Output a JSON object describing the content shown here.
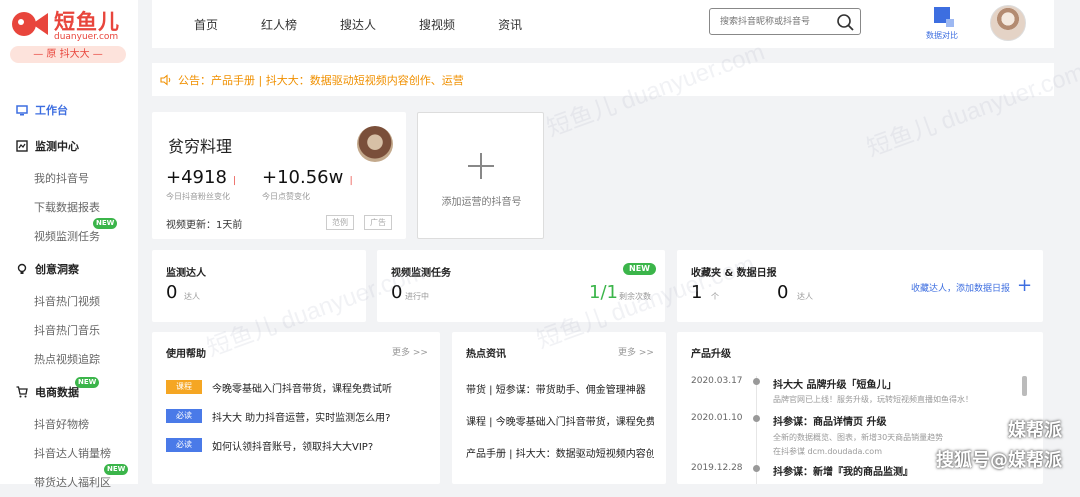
{
  "logo": {
    "brand": "短鱼儿",
    "domain": "duanyuer.com",
    "tagline": "— 原 抖大大 —",
    "accent": "#e8453c"
  },
  "sidebar": {
    "workbench": "工作台",
    "groups": [
      {
        "label": "监测中心",
        "items": [
          "我的抖音号",
          "下载数据报表",
          "视频监测任务"
        ]
      },
      {
        "label": "创意洞察",
        "items": [
          "抖音热门视频",
          "抖音热门音乐",
          "热点视频追踪"
        ]
      },
      {
        "label": "电商数据",
        "items": [
          "抖音好物榜",
          "抖音达人销量榜",
          "带货达人福利区"
        ]
      }
    ],
    "new_badge": "NEW"
  },
  "nav": {
    "items": [
      "首页",
      "红人榜",
      "搜达人",
      "搜视频",
      "资讯"
    ]
  },
  "search": {
    "placeholder": "搜索抖音昵称或抖音号"
  },
  "compare": {
    "label": "数据对比"
  },
  "notice": {
    "text": "公告：产品手册 | 抖大大：数据驱动短视频内容创作、运营"
  },
  "account": {
    "name": "贫穷料理",
    "fans_delta": "+4918",
    "fans_label": "今日抖音粉丝变化",
    "likes_delta": "+10.56w",
    "likes_label": "今日点赞变化",
    "updated": "视频更新：1天前",
    "tag1": "范例",
    "tag2": "广告"
  },
  "add_account": {
    "label": "添加运营的抖音号"
  },
  "monitor": {
    "title": "监测达人",
    "value": "0",
    "unit": "达人"
  },
  "video_task": {
    "title": "视频监测任务",
    "badge": "NEW",
    "running_value": "0",
    "running_label": "进行中",
    "remaining_value": "1/1",
    "remaining_label": "剩余次数"
  },
  "favorites": {
    "title": "收藏夹 & 数据日报",
    "count1": "1",
    "unit1": "个",
    "count2": "0",
    "unit2": "达人",
    "link": "收藏达人，添加数据日报"
  },
  "help": {
    "title": "使用帮助",
    "more": "更多 >>",
    "rows": [
      {
        "tag": "课程",
        "text": "今晚零基础入门抖音带货，课程免费试听",
        "color": "#f5a623"
      },
      {
        "tag": "必读",
        "text": "抖大大 助力抖音运营，实时监测怎么用?",
        "color": "#4a7ae8"
      },
      {
        "tag": "必读",
        "text": "如何认领抖音账号，领取抖大大VIP?",
        "color": "#4a7ae8"
      }
    ]
  },
  "hot_news": {
    "title": "热点资讯",
    "more": "更多 >>",
    "rows": [
      "带货 | 短参谋：带货助手、佣金管理神器",
      "课程 | 今晚零基础入门抖音带货，课程免费",
      "产品手册 | 抖大大：数据驱动短视频内容创"
    ]
  },
  "upgrades": {
    "title": "产品升级",
    "rows": [
      {
        "date": "2020.03.17",
        "title": "抖大大 品牌升级「短鱼儿」",
        "desc": [
          "品牌官网已上线！服务升级，玩转短视频直播如鱼得水！"
        ]
      },
      {
        "date": "2020.01.10",
        "title": "抖参谋：商品详情页 升级",
        "desc": [
          "全新的数据概览、图表，新增30天商品销量趋势",
          "在抖参谋 dcm.doudada.com"
        ]
      },
      {
        "date": "2019.12.28",
        "title": "抖参谋：新增『我的商品监测』",
        "desc": []
      }
    ]
  },
  "watermarks": [
    "短鱼儿 duanyuer.com",
    "短鱼儿 duanyuer.com",
    "短鱼儿 duanyuer.com",
    "短鱼儿 duanyuer.com"
  ],
  "signature": {
    "line1": "媒帮派",
    "line2": "搜狐号@媒帮派"
  }
}
